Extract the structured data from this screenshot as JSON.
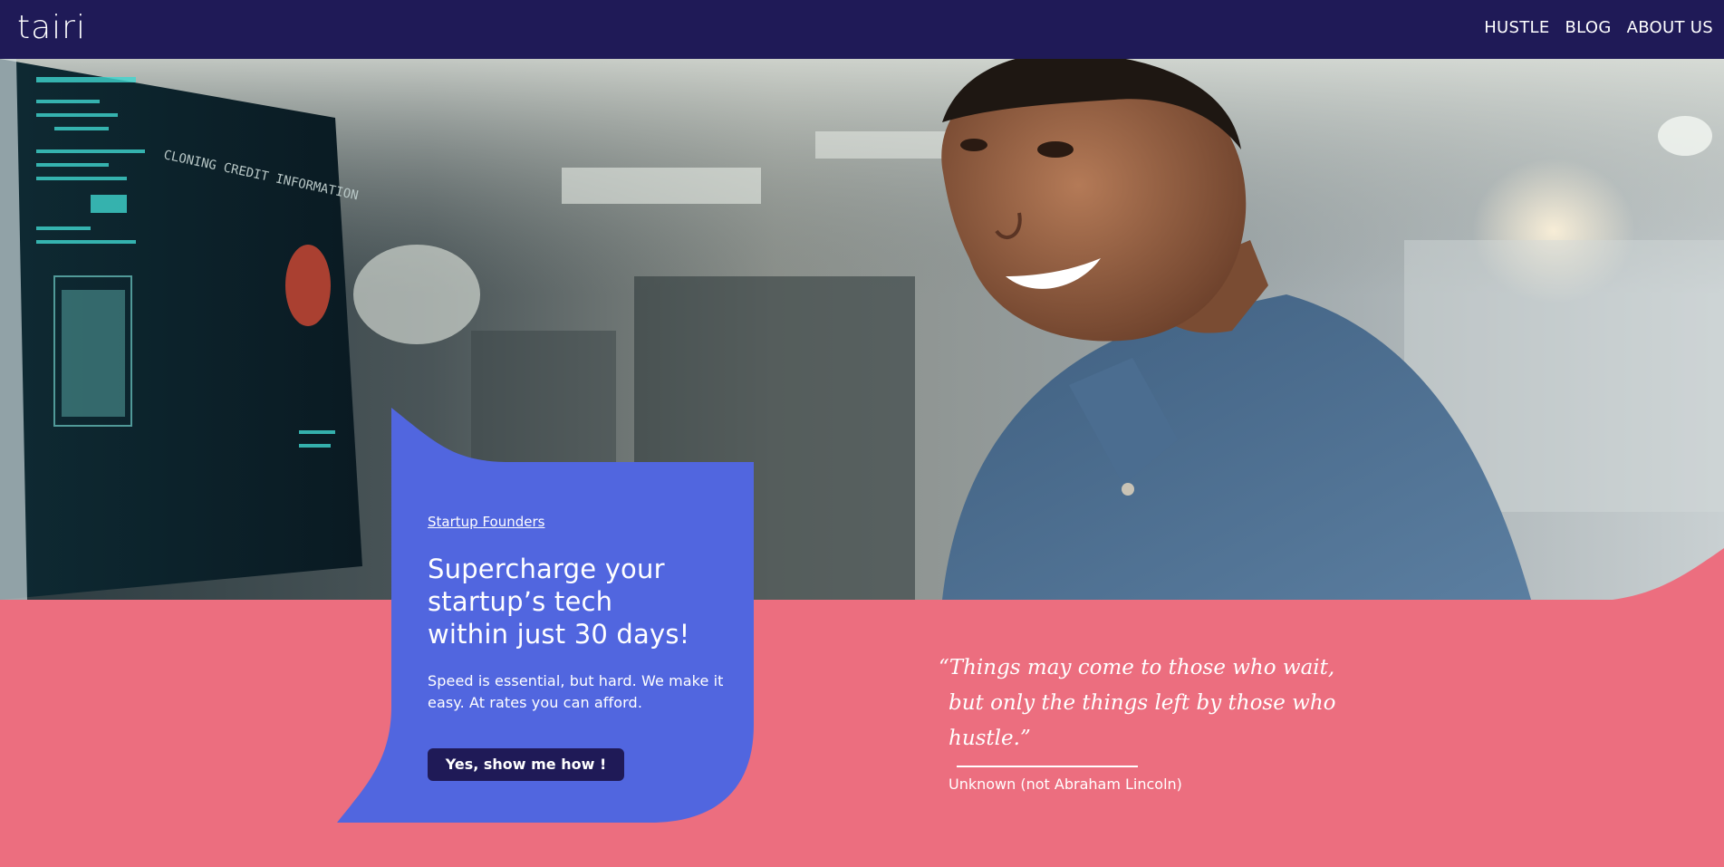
{
  "nav": {
    "logo": "tairi",
    "links": [
      "HUSTLE",
      "BLOG",
      "ABOUT US"
    ]
  },
  "hero": {
    "image": "smiling-developer-at-computer",
    "monitor_text": "CLONING CREDIT INFORMATION"
  },
  "card": {
    "eyebrow": "Startup Founders",
    "heading_lines": [
      "Supercharge your",
      "startup’s tech",
      "within just 30 days!"
    ],
    "text": "Speed is essential, but hard. We make it easy. At rates you can afford.",
    "cta_label": "Yes, show me how !"
  },
  "quote": {
    "text": "“Things may come to those who wait, but only the things left by those who hustle.”",
    "author": "Unknown (not Abraham Lincoln)"
  },
  "colors": {
    "navy": "#1f1a57",
    "card_blue": "#5166df",
    "pink": "#ec6e7f",
    "white": "#ffffff"
  }
}
